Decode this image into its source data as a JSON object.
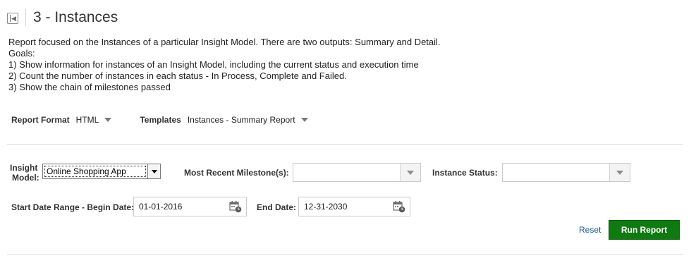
{
  "header": {
    "toggle_icon": "panel-collapse-icon",
    "title": "3 - Instances"
  },
  "description": {
    "lines": [
      "Report focused on the Instances of a particular Insight Model. There are two outputs: Summary and Detail.",
      "Goals:",
      "1) Show information for instances of an Insight Model, including the current status and execution time",
      "2) Count the number of instances in each status - In Process, Complete and Failed.",
      "3) Show the chain of milestones passed"
    ]
  },
  "report_options": {
    "format_label": "Report Format",
    "format_value": "HTML",
    "templates_label": "Templates",
    "templates_value": "Instances - Summary Report"
  },
  "params": {
    "insight_model": {
      "label_line1": "Insight",
      "label_line2": "Model:",
      "value": "Online Shopping App"
    },
    "milestones": {
      "label": "Most Recent Milestone(s):",
      "value": ""
    },
    "instance_status": {
      "label": "Instance Status:",
      "value": ""
    },
    "start_date": {
      "label": "Start Date Range - Begin Date:",
      "value": "01-01-2016"
    },
    "end_date": {
      "label": "End Date:",
      "value": "12-31-2030"
    }
  },
  "actions": {
    "reset_label": "Reset",
    "run_label": "Run Report"
  },
  "colors": {
    "run_button": "#0f7a12",
    "link": "#1a5a96",
    "divider": "#dddddd"
  }
}
